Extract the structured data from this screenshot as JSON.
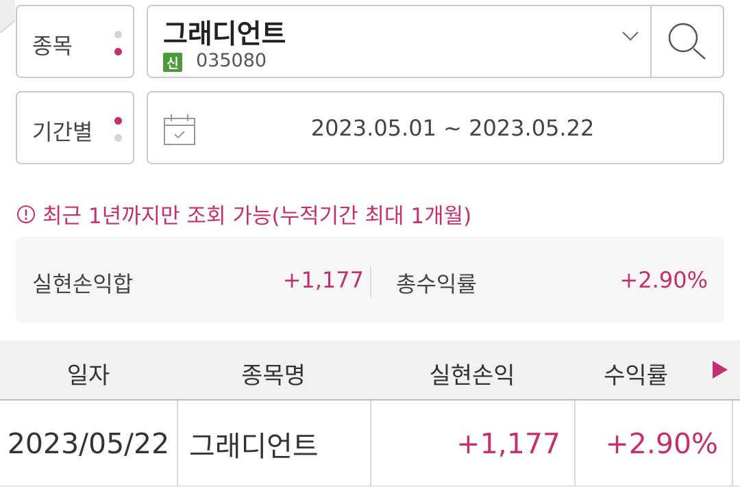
{
  "stock_selector": {
    "label": "종목",
    "name": "그래디언트",
    "badge": "신",
    "code": "035080"
  },
  "period_selector": {
    "label": "기간별",
    "date_range": "2023.05.01 ~ 2023.05.22"
  },
  "notice": "최근 1년까지만 조회 가능(누적기간 최대 1개월)",
  "summary": {
    "realized_pl_label": "실현손익합",
    "realized_pl_value": "+1,177",
    "total_return_label": "총수익률",
    "total_return_value": "+2.90%"
  },
  "table": {
    "headers": [
      "일자",
      "종목명",
      "실현손익",
      "수익률"
    ],
    "rows": [
      {
        "date": "2023/05/22",
        "name": "그래디언트",
        "pl": "+1,177",
        "rate": "+2.90%"
      }
    ]
  },
  "colors": {
    "accent": "#c2306e",
    "badge": "#4d9a3c",
    "border": "#c8c8c8"
  },
  "icons": [
    "search-icon",
    "chevron-down-icon",
    "calendar-icon",
    "info-icon",
    "play-right-icon"
  ]
}
